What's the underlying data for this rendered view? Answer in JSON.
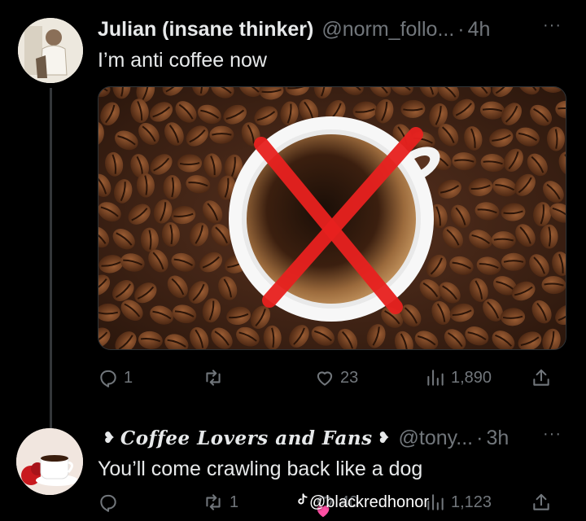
{
  "tweet1": {
    "display_name": "Julian (insane thinker)",
    "handle": "@norm_follo...",
    "separator": "·",
    "time": "4h",
    "more_icon": "more-dots-icon",
    "text": "I’m anti coffee now",
    "media": {
      "description_icon": "coffee-cup-crossed-out-image"
    },
    "actions": {
      "reply_count": "1",
      "retweet_count": "",
      "like_count": "23",
      "views_count": "1,890"
    }
  },
  "tweet2": {
    "display_name": "Coffee Lovers and Fans",
    "deco_left": "❥",
    "deco_right": "❥",
    "handle": "@tony...",
    "separator": "·",
    "time": "3h",
    "more_icon": "more-dots-icon",
    "text": "You’ll come crawling back like a dog",
    "actions": {
      "reply_count": "",
      "retweet_count": "1",
      "like_count": "40",
      "views_count": "1,123"
    }
  },
  "watermark": {
    "icon": "tiktok-icon",
    "text": "@blackredhonor"
  },
  "colors": {
    "background": "#000000",
    "primary_text": "#e7e9ea",
    "secondary_text": "#71767b",
    "cross_red": "#e8211f"
  }
}
